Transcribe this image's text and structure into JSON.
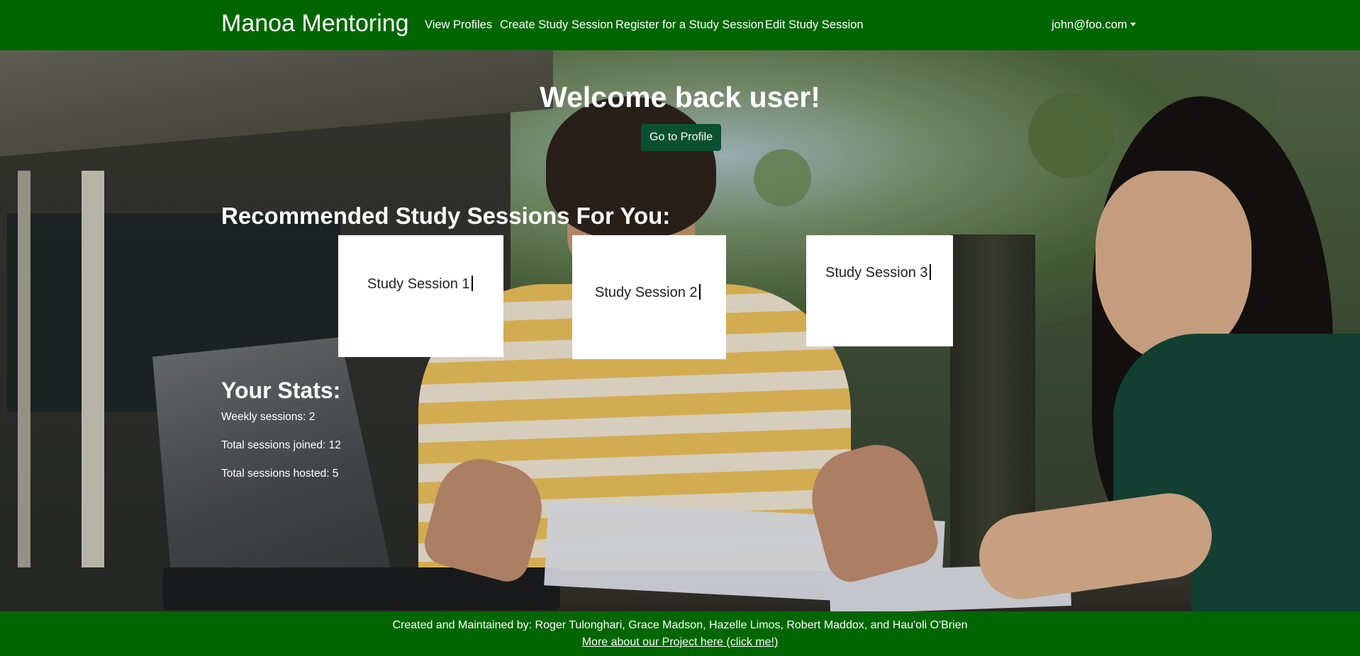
{
  "navbar": {
    "brand": "Manoa Mentoring",
    "links": [
      "View Profiles",
      "Create Study Session",
      "Register for a Study Session",
      "Edit Study Session"
    ],
    "user": "john@foo.com"
  },
  "hero": {
    "welcome": "Welcome back user!",
    "profile_button": "Go to Profile"
  },
  "recommended": {
    "heading": "Recommended Study Sessions For You:",
    "sessions": [
      "Study Session 1",
      "Study Session 2",
      "Study Session 3"
    ]
  },
  "stats": {
    "heading": "Your Stats:",
    "weekly": "Weekly sessions: 2",
    "joined": "Total sessions joined: 12",
    "hosted": "Total sessions hosted: 5"
  },
  "footer": {
    "credits": "Created and Maintained by: Roger Tulonghari, Grace Madson, Hazelle Limos, Robert Maddox, and Hau'oli O'Brien",
    "link": "More about our Project here (click me!)"
  },
  "colors": {
    "nav_green": "#006600",
    "button_green": "#0a5032"
  }
}
